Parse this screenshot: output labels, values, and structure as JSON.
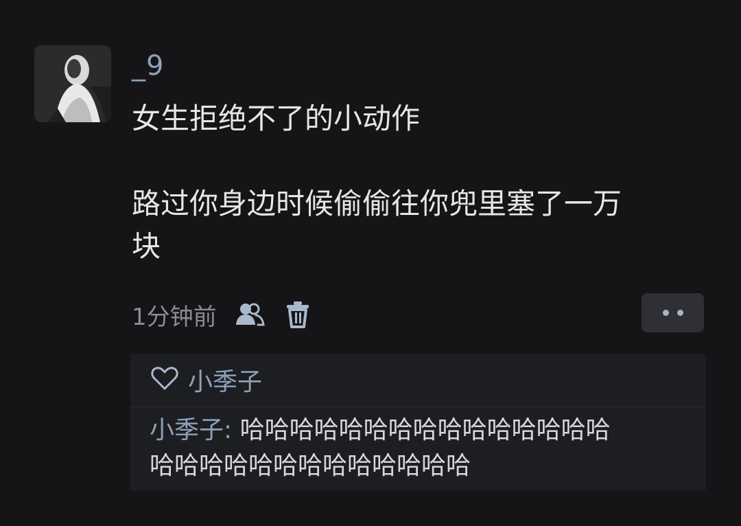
{
  "post": {
    "username": "_9",
    "title_line": "女生拒绝不了的小动作",
    "body_line1": "路过你身边时候偷偷往你兜里塞了一万",
    "body_line2": "块",
    "time": "1分钟前",
    "icons": {
      "users": "users-icon",
      "delete": "trash-icon",
      "more": "more-icon"
    }
  },
  "reply_box": {
    "like_icon": "heart-outline-icon",
    "liked_by": "小季子",
    "reply_author": "小季子:",
    "reply_line1": "哈哈哈哈哈哈哈哈哈哈哈哈哈哈哈",
    "reply_line2": "哈哈哈哈哈哈哈哈哈哈哈哈哈"
  },
  "colors": {
    "background": "#151517",
    "accent_blue": "#8da1ba",
    "text_primary": "#e6e6e8",
    "text_secondary": "#8a8c92",
    "reply_bg": "#1d1e21"
  }
}
